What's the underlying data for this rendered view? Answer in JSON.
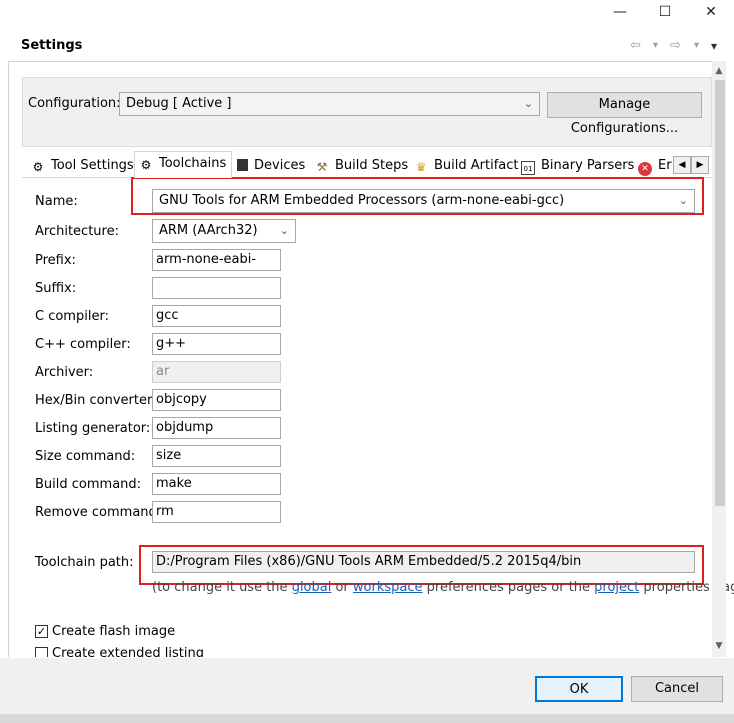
{
  "window": {
    "minimize_glyph": "—",
    "maximize_glyph": "☐",
    "close_glyph": "✕"
  },
  "header": {
    "title": "Settings",
    "back_glyph": "⇦",
    "forward_glyph": "⇨",
    "dropdown_glyph": "▾",
    "menu_glyph": "▾"
  },
  "configuration": {
    "label": "Configuration:",
    "value": "Debug  [ Active ]",
    "manage_button": "Manage Configurations..."
  },
  "tabs": [
    {
      "label": "Tool Settings",
      "icon": "gear-icon",
      "active": false
    },
    {
      "label": "Toolchains",
      "icon": "gear-icon",
      "active": true
    },
    {
      "label": "Devices",
      "icon": "chip-icon",
      "active": false
    },
    {
      "label": "Build Steps",
      "icon": "hammer-icon",
      "active": false
    },
    {
      "label": "Build Artifact",
      "icon": "trophy-icon",
      "active": false
    },
    {
      "label": "Binary Parsers",
      "icon": "binary-icon",
      "active": false
    },
    {
      "label": "Er",
      "icon": "error-icon",
      "active": false
    }
  ],
  "form": {
    "name": {
      "label": "Name:",
      "value": "GNU Tools for ARM Embedded Processors (arm-none-eabi-gcc)"
    },
    "architecture": {
      "label": "Architecture:",
      "value": "ARM (AArch32)"
    },
    "prefix": {
      "label": "Prefix:",
      "value": "arm-none-eabi-"
    },
    "suffix": {
      "label": "Suffix:",
      "value": ""
    },
    "c_compiler": {
      "label": "C compiler:",
      "value": "gcc"
    },
    "cpp_compiler": {
      "label": "C++ compiler:",
      "value": "g++"
    },
    "archiver": {
      "label": "Archiver:",
      "value": "ar"
    },
    "hexbin": {
      "label": "Hex/Bin converter:",
      "value": "objcopy"
    },
    "listing": {
      "label": "Listing generator:",
      "value": "objdump"
    },
    "size": {
      "label": "Size command:",
      "value": "size"
    },
    "build": {
      "label": "Build command:",
      "value": "make"
    },
    "remove": {
      "label": "Remove command:",
      "value": "rm"
    },
    "toolchain_path": {
      "label": "Toolchain path:",
      "value": "D:/Program Files (x86)/GNU Tools ARM Embedded/5.2 2015q4/bin"
    }
  },
  "hint": {
    "prefix": "(to change it use the ",
    "global": "global",
    "or": " or ",
    "workspace": "workspace",
    "middle": " preferences pages or the ",
    "project": "project",
    "suffix": " properties page)"
  },
  "checkboxes": {
    "flash_image": {
      "label": "Create flash image",
      "checked": true
    },
    "extended_listing": {
      "label": "Create extended listing",
      "checked": false
    }
  },
  "footer": {
    "ok": "OK",
    "cancel": "Cancel"
  },
  "colors": {
    "highlight": "#e02020",
    "link": "#1a5fb4",
    "ok_border": "#0078d7"
  }
}
